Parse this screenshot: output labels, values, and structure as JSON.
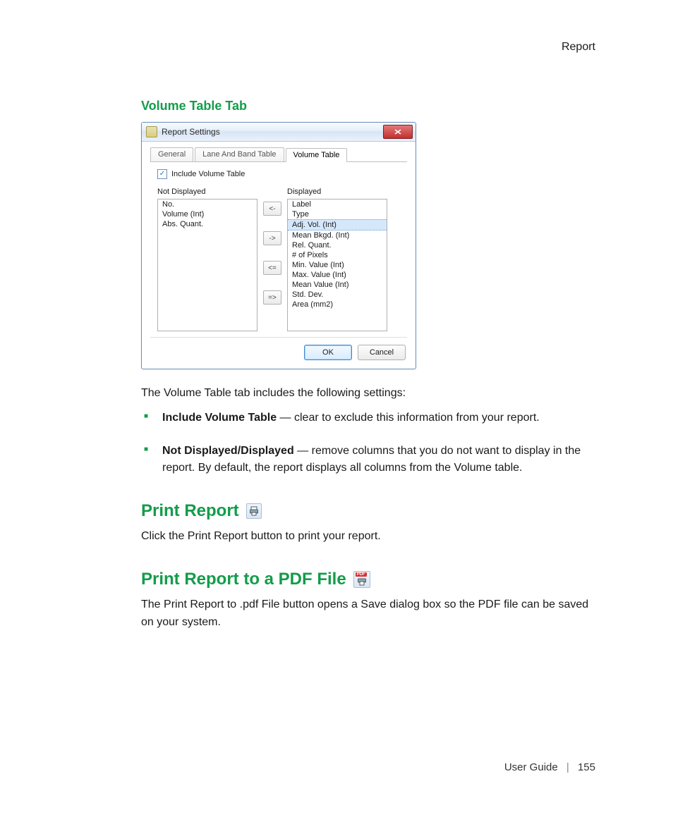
{
  "header_right": "Report",
  "section1_title": "Volume Table Tab",
  "dialog": {
    "title": "Report Settings",
    "tabs": [
      "General",
      "Lane And Band Table",
      "Volume Table"
    ],
    "active_tab_index": 2,
    "include_checkbox_label": "Include Volume Table",
    "include_checkbox_checked": true,
    "not_displayed_label": "Not Displayed",
    "displayed_label": "Displayed",
    "not_displayed_items": [
      "No.",
      "Volume (Int)",
      "Abs. Quant."
    ],
    "displayed_items": [
      "Label",
      "Type",
      "Adj. Vol. (Int)",
      "Mean Bkgd. (Int)",
      "Rel. Quant.",
      "# of Pixels",
      "Min. Value (Int)",
      "Max. Value (Int)",
      "Mean Value (Int)",
      "Std. Dev.",
      "Area (mm2)"
    ],
    "displayed_selected_index": 2,
    "arrows": [
      "<-",
      "->",
      "<=",
      "=>"
    ],
    "ok_label": "OK",
    "cancel_label": "Cancel"
  },
  "para_after_dialog": "The Volume Table tab includes the following settings:",
  "bullets": [
    {
      "bold": "Include Volume Table",
      "rest": " — clear to exclude this information from your report."
    },
    {
      "bold": "Not Displayed/Displayed",
      "rest": " — remove columns that you do not want to display in the report. By default, the report displays all columns from the Volume table."
    }
  ],
  "section2_title": "Print Report",
  "section2_para": "Click the Print Report button to print your report.",
  "section3_title": "Print Report to a PDF File",
  "section3_para": "The Print Report to .pdf File button opens a Save dialog box so the PDF file can be saved on your system.",
  "pdf_badge": "PDF",
  "footer_guide": "User Guide",
  "footer_page": "155"
}
